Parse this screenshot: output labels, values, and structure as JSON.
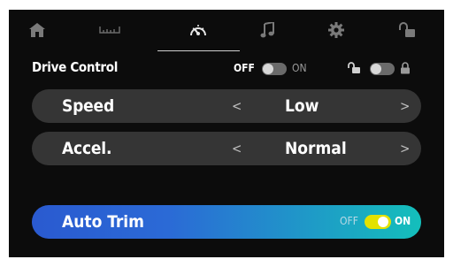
{
  "tabs": [
    {
      "icon": "home-icon"
    },
    {
      "icon": "ruler-icon"
    },
    {
      "icon": "speedometer-icon",
      "active": true
    },
    {
      "icon": "music-note-icon"
    },
    {
      "icon": "gear-icon"
    },
    {
      "icon": "unlock-icon"
    }
  ],
  "header": {
    "title": "Drive Control",
    "off_label": "OFF",
    "on_label": "ON",
    "drive_toggle": "off",
    "lock_toggle": "off"
  },
  "rows": [
    {
      "label": "Speed",
      "prev": "<",
      "value": "Low",
      "next": ">"
    },
    {
      "label": "Accel.",
      "prev": "<",
      "value": "Normal",
      "next": ">"
    }
  ],
  "auto_trim": {
    "label": "Auto Trim",
    "off_label": "OFF",
    "on_label": "ON",
    "state": "on"
  },
  "colors": {
    "background": "#0c0c0c",
    "row": "#353535",
    "toggle_on": "#e4e200",
    "gradient_start": "#2a5ad0",
    "gradient_end": "#14bfbb"
  }
}
